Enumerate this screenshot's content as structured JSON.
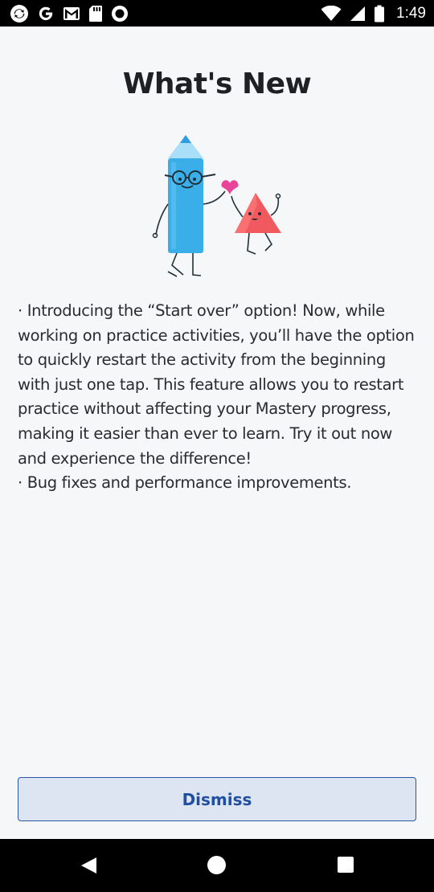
{
  "status_bar": {
    "time": "1:49",
    "left_icons": [
      "sync-icon",
      "google-icon",
      "gmail-icon",
      "sd-card-icon",
      "record-icon"
    ],
    "right_icons": [
      "wifi-icon",
      "signal-icon",
      "battery-icon"
    ]
  },
  "dialog": {
    "title": "What's New",
    "illustration": "pencil-and-triangle-illustration",
    "notes": [
      "· Introducing the “Start over” option! Now, while working on practice activities, you’ll have the option to quickly restart the activity from the beginning with just one tap. This feature allows you to restart practice without affecting your Mastery progress, making it easier than ever to learn. Try it out now and experience the difference!",
      "· Bug fixes and performance improvements."
    ],
    "dismiss_label": "Dismiss"
  },
  "nav_bar": {
    "icons": [
      "back-icon",
      "home-icon",
      "recents-icon"
    ]
  },
  "colors": {
    "accent": "#2b56a8",
    "button_bg": "#dde5f2",
    "background": "#f6f7f9",
    "pencil": "#3aaee8",
    "triangle": "#f05a5f",
    "heart": "#e8449a"
  }
}
